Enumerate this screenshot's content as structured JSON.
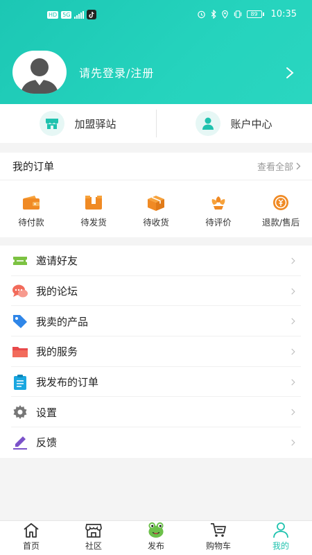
{
  "status_bar": {
    "left_chips": [
      "HD",
      "5G"
    ],
    "battery": "89",
    "time": "10:35"
  },
  "profile": {
    "login_text": "请先登录/注册"
  },
  "quick_links": [
    {
      "label": "加盟驿站",
      "icon": "station-icon"
    },
    {
      "label": "账户中心",
      "icon": "user-icon"
    }
  ],
  "orders": {
    "title": "我的订单",
    "view_all": "查看全部",
    "items": [
      {
        "label": "待付款",
        "icon": "wallet-icon"
      },
      {
        "label": "待发货",
        "icon": "package-icon"
      },
      {
        "label": "待收货",
        "icon": "box-icon"
      },
      {
        "label": "待评价",
        "icon": "flower-icon"
      },
      {
        "label": "退款/售后",
        "icon": "refund-icon"
      }
    ]
  },
  "menu": [
    {
      "label": "邀请好友",
      "icon": "ticket-icon"
    },
    {
      "label": "我的论坛",
      "icon": "chat-icon"
    },
    {
      "label": "我卖的产品",
      "icon": "tag-icon"
    },
    {
      "label": "我的服务",
      "icon": "folder-icon"
    },
    {
      "label": "我发布的订单",
      "icon": "clipboard-icon"
    },
    {
      "label": "设置",
      "icon": "gear-icon"
    },
    {
      "label": "反馈",
      "icon": "edit-icon"
    }
  ],
  "tabbar": [
    {
      "label": "首页",
      "icon": "home-icon"
    },
    {
      "label": "社区",
      "icon": "store-icon"
    },
    {
      "label": "发布",
      "icon": "frog-icon"
    },
    {
      "label": "购物车",
      "icon": "cart-icon"
    },
    {
      "label": "我的",
      "icon": "person-icon",
      "active": true
    }
  ],
  "colors": {
    "accent": "#1fc2ae",
    "header_gradient_start": "#1cc7b4",
    "header_gradient_end": "#2ad6c0"
  }
}
